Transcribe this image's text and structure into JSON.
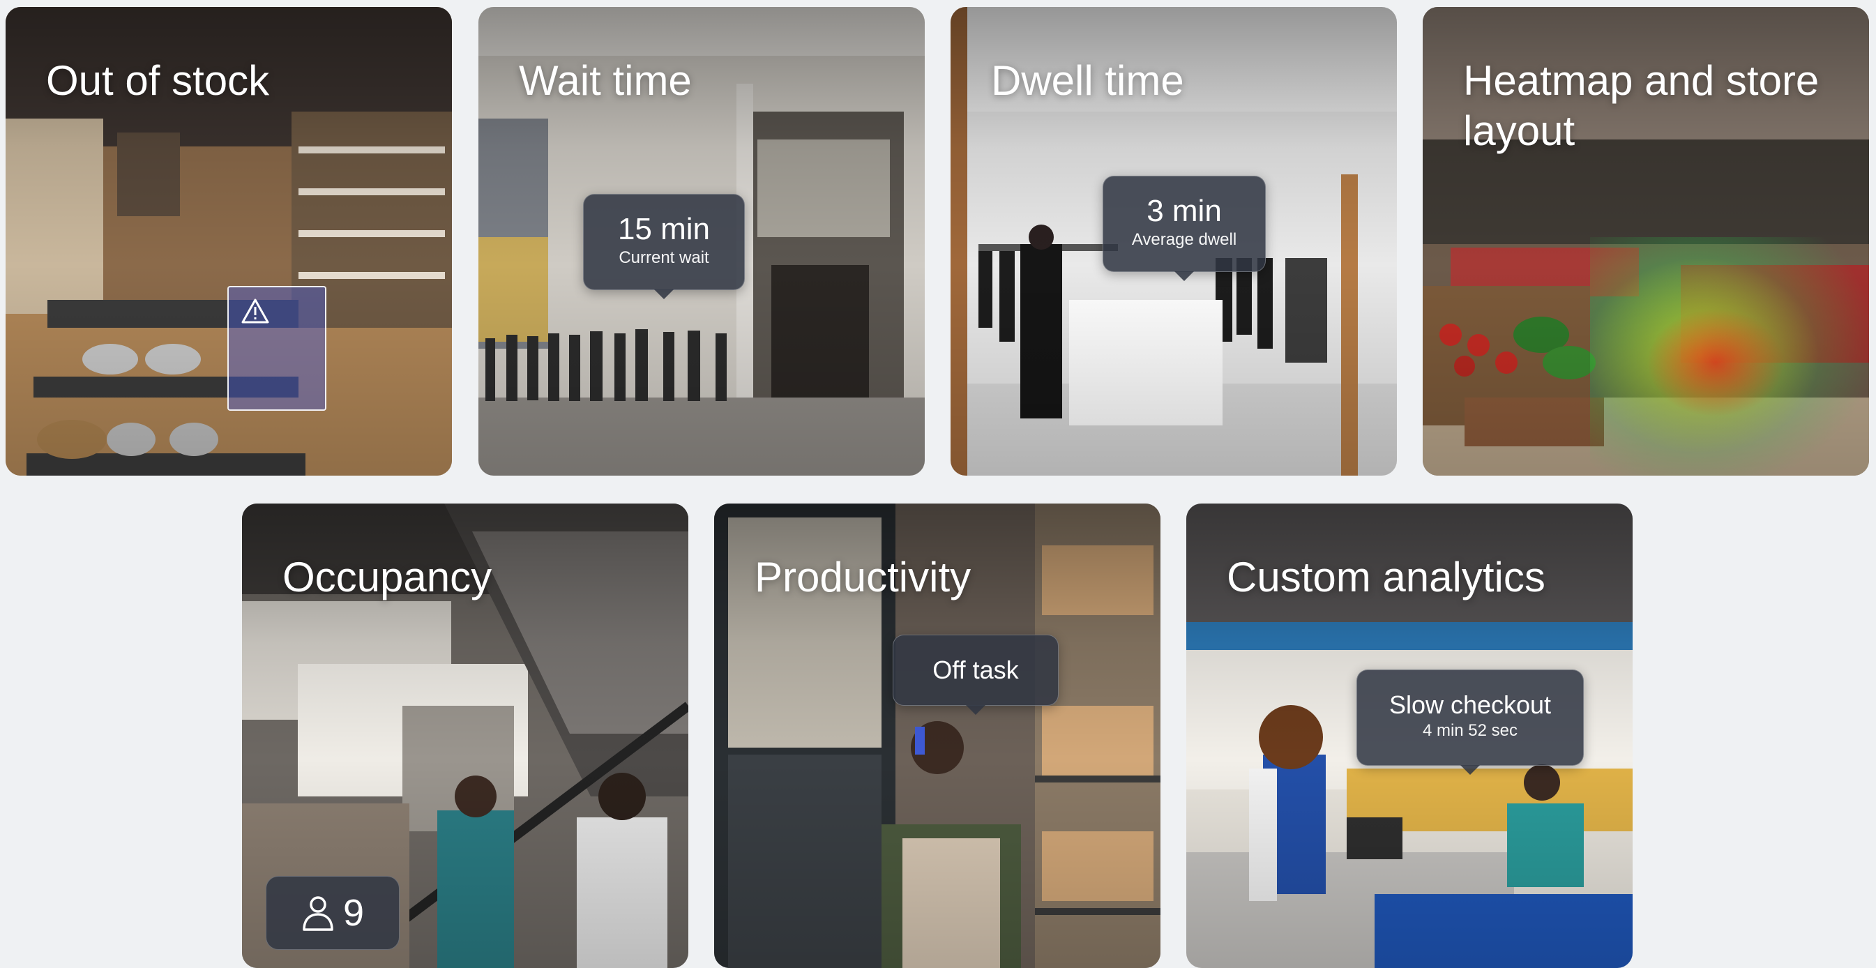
{
  "cards": [
    {
      "title": "Out of stock",
      "icon": "warning-icon"
    },
    {
      "title": "Wait time",
      "bubble": {
        "value": "15 min",
        "caption": "Current wait"
      }
    },
    {
      "title": "Dwell time",
      "bubble": {
        "value": "3 min",
        "caption": "Average dwell"
      }
    },
    {
      "title": "Heatmap and store layout"
    },
    {
      "title": "Occupancy",
      "count": {
        "icon": "person-icon",
        "value": "9"
      }
    },
    {
      "title": "Productivity",
      "bubble": {
        "value": "Off task"
      }
    },
    {
      "title": "Custom analytics",
      "bubble": {
        "value": "Slow checkout",
        "caption": "4 min 52 sec"
      }
    }
  ],
  "colors": {
    "page_background": "#eff1f3",
    "overlay": "#30364a",
    "text": "#ffffff"
  }
}
